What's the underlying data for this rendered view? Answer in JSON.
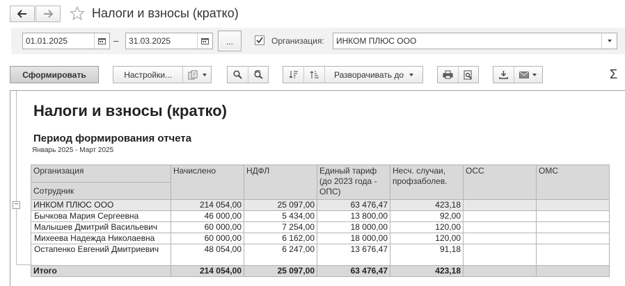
{
  "window": {
    "title": "Налоги и взносы (кратко)"
  },
  "filters": {
    "date_from": "01.01.2025",
    "dash": "–",
    "date_to": "31.03.2025",
    "period_button": "...",
    "org_checked": true,
    "org_label": "Организация:",
    "org_value": "ИНКОМ ПЛЮС ООО"
  },
  "toolbar": {
    "generate": "Сформировать",
    "settings": "Настройки...",
    "expand": "Разворачивать до",
    "sum": "Σ"
  },
  "report": {
    "title": "Налоги и взносы (кратко)",
    "subtitle": "Период формирования отчета",
    "period": "Январь 2025 - Март 2025",
    "headers": {
      "org": "Организация",
      "employee": "Сотрудник",
      "accrued": "Начислено",
      "ndfl": "НДФЛ",
      "single_tariff": "Единый тариф (до 2023 года - ОПС)",
      "accident": "Несч. случаи, профзаболев.",
      "oss": "ОСС",
      "oms": "ОМС"
    },
    "group": {
      "toggle": "−",
      "name": "ИНКОМ ПЛЮС ООО",
      "accrued": "214 054,00",
      "ndfl": "25 097,00",
      "single_tariff": "63 476,47",
      "accident": "423,18",
      "oss": "",
      "oms": ""
    },
    "rows": [
      {
        "name": "Бычкова Мария Сергеевна",
        "accrued": "46 000,00",
        "ndfl": "5 434,00",
        "single_tariff": "13 800,00",
        "accident": "92,00",
        "oss": "",
        "oms": ""
      },
      {
        "name": "Малышев Дмитрий Васильевич",
        "accrued": "60 000,00",
        "ndfl": "7 254,00",
        "single_tariff": "18 000,00",
        "accident": "120,00",
        "oss": "",
        "oms": ""
      },
      {
        "name": "Михеева Надежда Николаевна",
        "accrued": "60 000,00",
        "ndfl": "6 162,00",
        "single_tariff": "18 000,00",
        "accident": "120,00",
        "oss": "",
        "oms": ""
      },
      {
        "name": "Остапенко Евгений Дмитриевич",
        "accrued": "48 054,00",
        "ndfl": "6 247,00",
        "single_tariff": "13 676,47",
        "accident": "91,18",
        "oss": "",
        "oms": ""
      }
    ],
    "total": {
      "label": "Итого",
      "accrued": "214 054,00",
      "ndfl": "25 097,00",
      "single_tariff": "63 476,47",
      "accident": "423,18",
      "oss": "",
      "oms": ""
    }
  }
}
